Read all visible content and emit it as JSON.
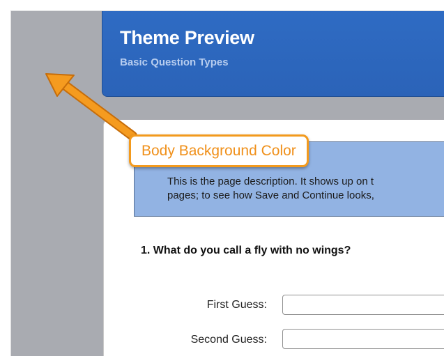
{
  "header": {
    "title": "Theme Preview",
    "subtitle": "Basic Question Types"
  },
  "description": {
    "line1": "This is the page description. It shows up on t",
    "line2": "pages; to see how Save and Continue looks,"
  },
  "question": {
    "title": "1. What do you call a fly with no wings?",
    "fields": [
      {
        "label": "First Guess:",
        "value": ""
      },
      {
        "label": "Second Guess:",
        "value": ""
      }
    ]
  },
  "annotation": {
    "label": "Body Background Color"
  },
  "colors": {
    "body_background": "#a9abb1",
    "header": "#2f6cc4",
    "description_background": "#92b3e3",
    "callout_accent": "#f39a1d"
  }
}
